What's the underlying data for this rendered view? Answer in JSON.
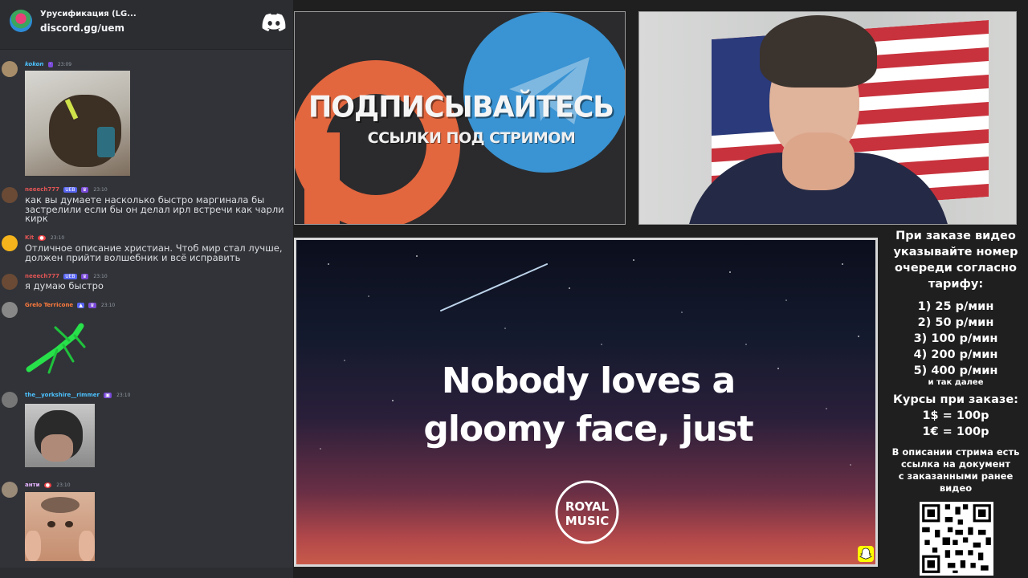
{
  "chat": {
    "server_name": "Урусификация (LG...",
    "invite": "discord.gg/uem",
    "messages": [
      {
        "user": "kokon",
        "time": "23:09",
        "text": "",
        "color": "#4cc2ff"
      },
      {
        "user": "neeech777",
        "badges": [
          "UEB"
        ],
        "time": "23:10",
        "text": "как вы думаете насколько быстро маргинала бы застрелили если бы он делал ирл встречи как чарли кирк",
        "color": "#e25555"
      },
      {
        "user": "Kit",
        "time": "23:10",
        "text": "Отличное описание христиан. Чтоб мир стал лучше, должен прийти волшебник и всё исправить",
        "color": "#e25555"
      },
      {
        "user": "neeech777",
        "badges": [
          "UEB"
        ],
        "time": "23:10",
        "text": "я думаю быстро",
        "color": "#e25555"
      },
      {
        "user": "Grelo Terricone",
        "time": "23:10",
        "text": "",
        "color": "#ff7a3d"
      },
      {
        "user": "the__yorkshire__rimmer",
        "time": "23:10",
        "text": "",
        "color": "#4cc2ff"
      },
      {
        "user": "анти",
        "time": "23:10",
        "text": "",
        "color": "#e6b3ff"
      }
    ]
  },
  "promo": {
    "title": "ПОДПИСЫВАЙТЕСЬ",
    "subtitle": "ССЫЛКИ ПОД СТРИМОМ"
  },
  "video": {
    "lyric_line1": "Nobody loves a",
    "lyric_line2": "gloomy face, just",
    "logo_text1": "ROYAL",
    "logo_text2": "MUSIC"
  },
  "info": {
    "heading": [
      "При заказе видео",
      "указывайте номер",
      "очереди согласно",
      "тарифу:"
    ],
    "prices": [
      "1) 25 р/мин",
      "2) 50 р/мин",
      "3) 100 р/мин",
      "4) 200 р/мин",
      "5) 400 р/мин"
    ],
    "etc": "и так далее",
    "rates_heading": "Курсы при заказе:",
    "rates": [
      "1$ = 100р",
      "1€ = 100р"
    ],
    "desc": [
      "В описании стрима есть",
      "ссылка на документ",
      "с заказанными ранее",
      "видео"
    ]
  },
  "colors": {
    "discord_bg": "#313338",
    "accent_orange": "#e2663e",
    "accent_blue": "#3a93d2"
  }
}
